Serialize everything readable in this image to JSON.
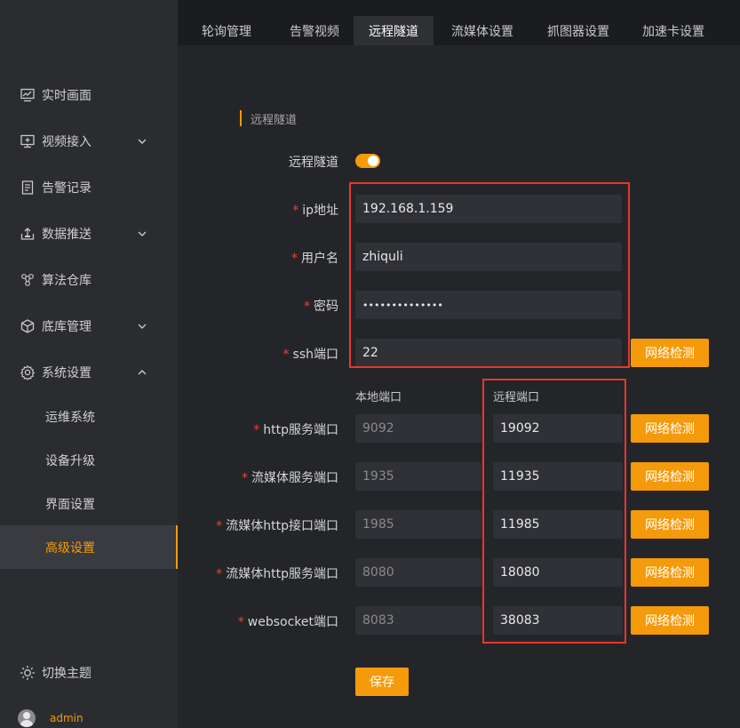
{
  "sidebar": {
    "items": [
      {
        "label": "实时画面",
        "icon": "monitor-chart-icon"
      },
      {
        "label": "视频接入",
        "icon": "display-icon",
        "chevron": "down"
      },
      {
        "label": "告警记录",
        "icon": "document-icon"
      },
      {
        "label": "数据推送",
        "icon": "upload-icon",
        "chevron": "down"
      },
      {
        "label": "算法仓库",
        "icon": "algorithm-icon"
      },
      {
        "label": "底库管理",
        "icon": "box-icon",
        "chevron": "down"
      },
      {
        "label": "系统设置",
        "icon": "gear-icon",
        "chevron": "up"
      }
    ],
    "sub_items": [
      {
        "label": "运维系统"
      },
      {
        "label": "设备升级"
      },
      {
        "label": "界面设置"
      },
      {
        "label": "高级设置",
        "active": true
      }
    ],
    "theme_label": "切换主题",
    "username": "admin"
  },
  "tabs": [
    {
      "label": "轮询管理"
    },
    {
      "label": "告警视频"
    },
    {
      "label": "远程隧道",
      "active": true
    },
    {
      "label": "流媒体设置"
    },
    {
      "label": "抓图器设置"
    },
    {
      "label": "加速卡设置"
    }
  ],
  "form": {
    "section_title": "远程隧道",
    "tunnel_label": "远程隧道",
    "tunnel_enabled": true,
    "required_mark": "*",
    "ip_label": "ip地址",
    "ip_value": "192.168.1.159",
    "username_label": "用户名",
    "username_value": "zhiquli",
    "password_label": "密码",
    "password_value": "••••••••••••••",
    "ssh_label": "ssh端口",
    "ssh_value": "22",
    "local_port_header": "本地端口",
    "remote_port_header": "远程端口",
    "check_button_label": "网络检测",
    "save_button_label": "保存",
    "ports": [
      {
        "label": "http服务端口",
        "local": "9092",
        "remote": "19092"
      },
      {
        "label": "流媒体服务端口",
        "local": "1935",
        "remote": "11935"
      },
      {
        "label": "流媒体http接口端口",
        "local": "1985",
        "remote": "11985"
      },
      {
        "label": "流媒体http服务端口",
        "local": "8080",
        "remote": "18080"
      },
      {
        "label": "websocket端口",
        "local": "8083",
        "remote": "38083"
      }
    ]
  },
  "colors": {
    "accent": "#f59a0b",
    "highlight_box": "#e8372c",
    "required": "#e8463b",
    "sidebar_bg": "#2b2c30",
    "content_bg": "#242529"
  }
}
